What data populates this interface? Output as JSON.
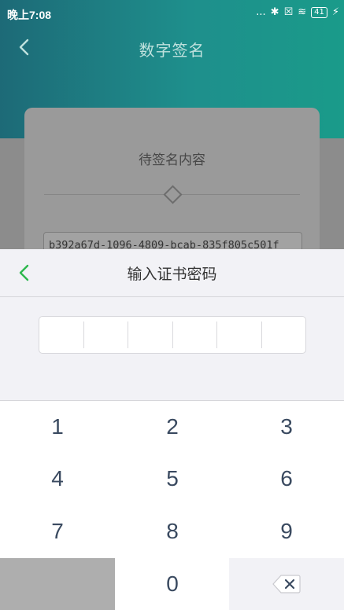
{
  "status_bar": {
    "time": "晚上7:08",
    "dots": "...",
    "bluetooth": "✱",
    "sim": "☒",
    "wifi": "≋",
    "battery": "41"
  },
  "page": {
    "title": "数字签名",
    "card_title": "待签名内容",
    "content_id": "b392a67d-1096-4809-bcab-835f805c501f"
  },
  "sheet": {
    "title": "输入证书密码",
    "cells": [
      "",
      "",
      "",
      "",
      "",
      ""
    ]
  },
  "keypad": {
    "keys": [
      "1",
      "2",
      "3",
      "4",
      "5",
      "6",
      "7",
      "8",
      "9",
      "0"
    ]
  },
  "colors": {
    "accent_green": "#2db84d",
    "key_text": "#3a4a60",
    "header_teal": "#1e8f8c"
  }
}
